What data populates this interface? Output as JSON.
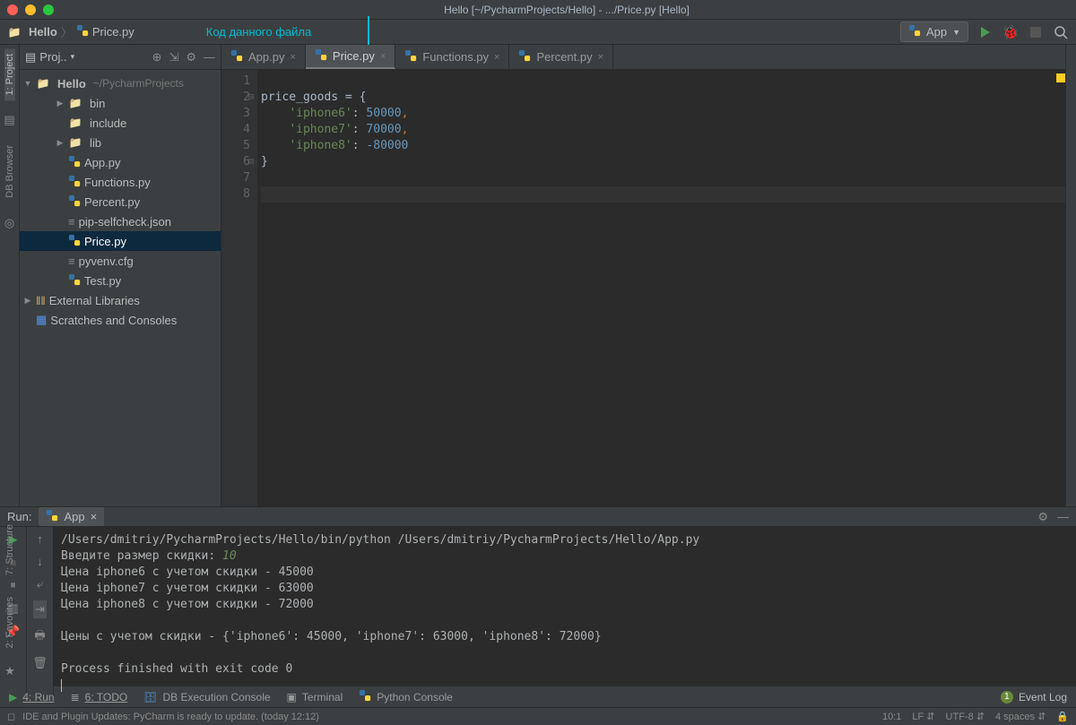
{
  "title": "Hello [~/PycharmProjects/Hello] - .../Price.py [Hello]",
  "breadcrumb": {
    "project": "Hello",
    "file": "Price.py"
  },
  "annotation": "Код данного файла",
  "run_config": {
    "name": "App"
  },
  "project_panel": {
    "title": "Proj..",
    "root": {
      "name": "Hello",
      "path": "~/PycharmProjects"
    },
    "items": [
      {
        "name": "bin",
        "type": "folder",
        "indent": 2,
        "caret": "▶"
      },
      {
        "name": "include",
        "type": "folder",
        "indent": 2,
        "caret": ""
      },
      {
        "name": "lib",
        "type": "folder",
        "indent": 2,
        "caret": "▶"
      },
      {
        "name": "App.py",
        "type": "py",
        "indent": 2,
        "caret": ""
      },
      {
        "name": "Functions.py",
        "type": "py",
        "indent": 2,
        "caret": ""
      },
      {
        "name": "Percent.py",
        "type": "py",
        "indent": 2,
        "caret": ""
      },
      {
        "name": "pip-selfcheck.json",
        "type": "file",
        "indent": 2,
        "caret": ""
      },
      {
        "name": "Price.py",
        "type": "py",
        "indent": 2,
        "caret": "",
        "selected": true
      },
      {
        "name": "pyvenv.cfg",
        "type": "file",
        "indent": 2,
        "caret": ""
      },
      {
        "name": "Test.py",
        "type": "py",
        "indent": 2,
        "caret": ""
      }
    ],
    "external": "External Libraries",
    "scratches": "Scratches and Consoles"
  },
  "editor_tabs": [
    {
      "label": "App.py",
      "active": false
    },
    {
      "label": "Price.py",
      "active": true
    },
    {
      "label": "Functions.py",
      "active": false
    },
    {
      "label": "Percent.py",
      "active": false
    }
  ],
  "code": {
    "lines": [
      "1",
      "2",
      "3",
      "4",
      "5",
      "6",
      "7",
      "8"
    ],
    "l2_a": "price_goods ",
    "l2_b": "=",
    "l2_c": " {",
    "l3_s": "'iphone6'",
    "l3_c": ":",
    "l3_n": " 50000",
    "l3_t": ",",
    "l4_s": "'iphone7'",
    "l4_c": ":",
    "l4_n": " 70000",
    "l4_t": ",",
    "l5_s": "'iphone8'",
    "l5_c": ":",
    "l5_n": " -80000",
    "l6": "}"
  },
  "run": {
    "title": "Run:",
    "tab": "App",
    "lines": [
      "/Users/dmitriy/PycharmProjects/Hello/bin/python /Users/dmitriy/PycharmProjects/Hello/App.py",
      "Введите размер скидки: ",
      "Цена iphone6 с учетом скидки - 45000",
      "Цена iphone7 с учетом скидки - 63000",
      "Цена iphone8 с учетом скидки - 72000",
      "",
      "Цены с учетом скидки - {'iphone6': 45000, 'iphone7': 63000, 'iphone8': 72000}",
      "",
      "Process finished with exit code 0"
    ],
    "input": "10"
  },
  "side_tabs": {
    "project": "1: Project",
    "db": "DB Browser",
    "structure": "7: Structure",
    "favorites": "2: Favorites"
  },
  "bottom_tabs": {
    "run": "4: Run",
    "todo": "6: TODO",
    "dbexec": "DB Execution Console",
    "terminal": "Terminal",
    "pyconsole": "Python Console",
    "eventlog": "Event Log"
  },
  "status": {
    "msg": "IDE and Plugin Updates: PyCharm is ready to update. (today 12:12)",
    "pos": "10:1",
    "le": "LF",
    "enc": "UTF-8",
    "indent": "4 spaces"
  }
}
